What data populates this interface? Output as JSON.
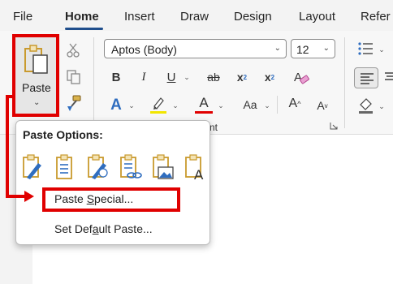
{
  "tabs": [
    {
      "label": "File"
    },
    {
      "label": "Home",
      "active": true
    },
    {
      "label": "Insert"
    },
    {
      "label": "Draw"
    },
    {
      "label": "Design"
    },
    {
      "label": "Layout"
    },
    {
      "label": "Refer"
    }
  ],
  "clipboard": {
    "paste_label": "Paste"
  },
  "font": {
    "name": "Aptos (Body)",
    "size": "12",
    "group_label": "nt"
  },
  "font_buttons": {
    "bold": "B",
    "italic": "I",
    "underline": "U",
    "strike": "ab",
    "sub": "x",
    "sup": "x",
    "effects": "A",
    "color": "A",
    "case": "Aa",
    "grow": "A",
    "shrink": "A"
  },
  "popup": {
    "title": "Paste Options:",
    "paste_special_pre": "Paste ",
    "paste_special_u": "S",
    "paste_special_post": "pecial...",
    "set_default_pre": "Set Def",
    "set_default_u": "a",
    "set_default_post": "ult Paste..."
  },
  "colors": {
    "highlight_red": "#e00000",
    "accent_blue": "#1f4e8c",
    "icon_blue": "#2f6dbf",
    "icon_gold": "#c99a2e"
  }
}
